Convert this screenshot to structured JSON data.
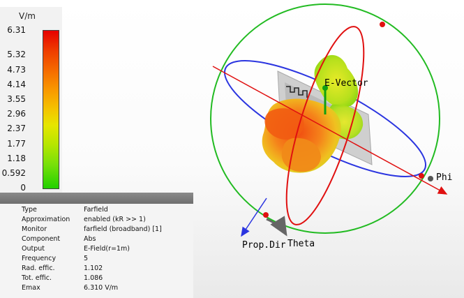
{
  "legend": {
    "unit": "V/m",
    "ticks": [
      "6.31",
      "5.32",
      "4.73",
      "4.14",
      "3.55",
      "2.96",
      "2.37",
      "1.77",
      "1.18",
      "0.592",
      "0"
    ],
    "tick_values": [
      6.31,
      5.32,
      4.73,
      4.14,
      3.55,
      2.96,
      2.37,
      1.77,
      1.18,
      0.592,
      0
    ],
    "max": 6.31
  },
  "info": {
    "rows": [
      {
        "key": "Type",
        "value": "Farfield"
      },
      {
        "key": "Approximation",
        "value": "enabled (kR >> 1)"
      },
      {
        "key": "Monitor",
        "value": "farfield (broadband) [1]"
      },
      {
        "key": "Component",
        "value": "Abs"
      },
      {
        "key": "Output",
        "value": "E-Field(r=1m)"
      },
      {
        "key": "Frequency",
        "value": "5"
      },
      {
        "key": "Rad. effic.",
        "value": "1.102"
      },
      {
        "key": "Tot. effic.",
        "value": "1.086"
      },
      {
        "key": "Emax",
        "value": "6.310 V/m"
      }
    ]
  },
  "scene": {
    "labels": {
      "e_vector": "E-Vector",
      "phi": "Phi",
      "theta": "Theta",
      "prop_dir": "Prop.Dir"
    },
    "colors": {
      "outer_circle": "#22bb22",
      "theta_ring": "#e01010",
      "phi_ring": "#2b35e0",
      "e_vector": "#10a010",
      "theta_arrow": "#666666"
    }
  }
}
